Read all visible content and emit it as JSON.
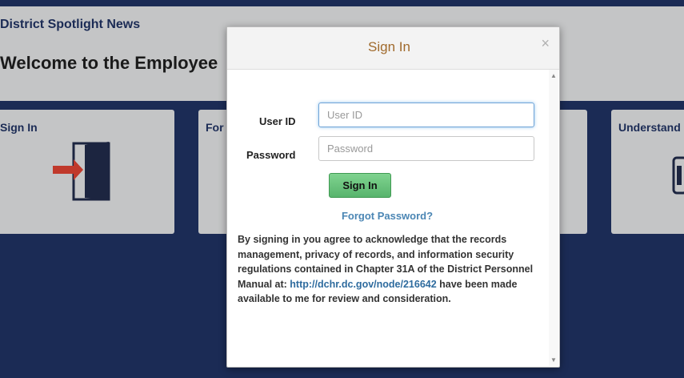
{
  "page": {
    "spotlight_title": "District Spotlight News",
    "welcome_text": "Welcome to the Employee"
  },
  "tiles": [
    {
      "label": "Sign In",
      "icon": "sign-in-door-icon"
    },
    {
      "label": "For",
      "icon": ""
    },
    {
      "label": "",
      "icon": ""
    },
    {
      "label": "Understand",
      "icon": "partial-icon"
    }
  ],
  "modal": {
    "title": "Sign In",
    "close_label": "×",
    "user_label": "User ID",
    "user_placeholder": "User ID",
    "user_value": "",
    "password_label": "Password",
    "password_placeholder": "Password",
    "password_value": "",
    "signin_button": "Sign In",
    "forgot_link": "Forgot Password?",
    "disclaimer_pre": "By signing in you agree to acknowledge that the records management, privacy of records, and information security regulations contained in Chapter 31A of the District Personnel Manual at: ",
    "disclaimer_link": "http://dchr.dc.gov/node/216642",
    "disclaimer_post": " have been made available to me for review and consideration."
  },
  "colors": {
    "navy": "#1b2b55",
    "tile_gray": "#c4c5c6",
    "title_orange": "#a06a2c",
    "button_green": "#58b46d",
    "link_blue": "#4b86b4"
  }
}
